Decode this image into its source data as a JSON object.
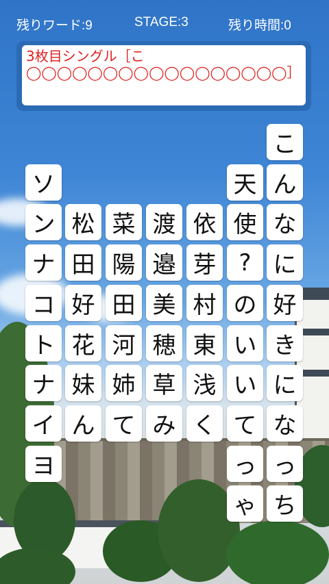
{
  "hud": {
    "words_left": "残りワード:9",
    "stage": "STAGE:3",
    "time_left": "残り時間:0"
  },
  "message": {
    "text": "3枚目シングル［こ◯◯◯◯◯◯◯◯◯◯◯◯◯◯◯◯◯］"
  },
  "columns": [
    {
      "id": "col1",
      "tiles": [
        "ソ",
        "ン",
        "ナ",
        "コ",
        "ト",
        "ナ",
        "イ",
        "ヨ"
      ]
    },
    {
      "id": "col2",
      "tiles": [
        "松",
        "田",
        "好",
        "花",
        "妹",
        "ん"
      ]
    },
    {
      "id": "col3",
      "tiles": [
        "菜",
        "陽",
        "田",
        "河",
        "姉",
        "て"
      ]
    },
    {
      "id": "col4",
      "tiles": [
        "渡",
        "邉",
        "美",
        "穂",
        "草",
        "み"
      ]
    },
    {
      "id": "col5",
      "tiles": [
        "依",
        "芽",
        "村",
        "東",
        "浅",
        "く"
      ]
    },
    {
      "id": "col6",
      "tiles": [
        "天",
        "使",
        "?",
        "の",
        "い",
        "い",
        "て",
        "っ",
        "ゃ"
      ]
    },
    {
      "id": "col7",
      "tiles": [
        "こ",
        "ん",
        "な",
        "に",
        "好",
        "き",
        "に",
        "な",
        "っ",
        "ち"
      ]
    }
  ]
}
